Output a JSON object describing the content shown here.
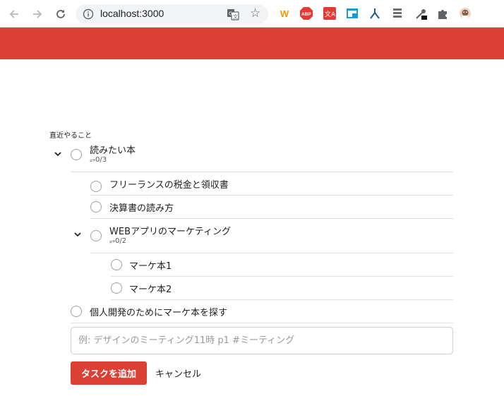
{
  "browser": {
    "url": "localhost:3000",
    "extensions": [
      {
        "name": "w-extension-icon",
        "glyph": "W",
        "color": "#f29900"
      },
      {
        "name": "adblock-icon",
        "glyph": "ABP",
        "color": "#e53935"
      },
      {
        "name": "translate-ext-icon",
        "glyph": "文A",
        "color": "#e53935"
      },
      {
        "name": "window-ext-icon",
        "glyph": "",
        "color": "#1a9ad6"
      },
      {
        "name": "fork-ext-icon",
        "glyph": "",
        "color": "#1e5a8a"
      },
      {
        "name": "stack-ext-icon",
        "glyph": "",
        "color": "#6e6e6e"
      },
      {
        "name": "eyedropper-ext-icon",
        "glyph": "",
        "color": "#5f6368"
      },
      {
        "name": "puzzle-extensions-icon",
        "glyph": "",
        "color": "#5f6368"
      },
      {
        "name": "profile-avatar-icon",
        "glyph": "",
        "color": "#8a5a3c"
      }
    ]
  },
  "app": {
    "header_color": "#db4035"
  },
  "section": {
    "title": "直近やること"
  },
  "tasks": [
    {
      "label": "読みたい本",
      "sub_count": "⥅0/3"
    },
    {
      "label": "フリーランスの税金と領収書"
    },
    {
      "label": "決算書の読み方"
    },
    {
      "label": "WEBアプリのマーケティング",
      "sub_count": "⥅0/2"
    },
    {
      "label": "マーケ本1"
    },
    {
      "label": "マーケ本2"
    },
    {
      "label": "個人開発のためにマーケ本を探す"
    }
  ],
  "form": {
    "placeholder": "例: デザインのミーティング11時 p1 #ミーティング",
    "add_label": "タスクを追加",
    "cancel_label": "キャンセル"
  }
}
